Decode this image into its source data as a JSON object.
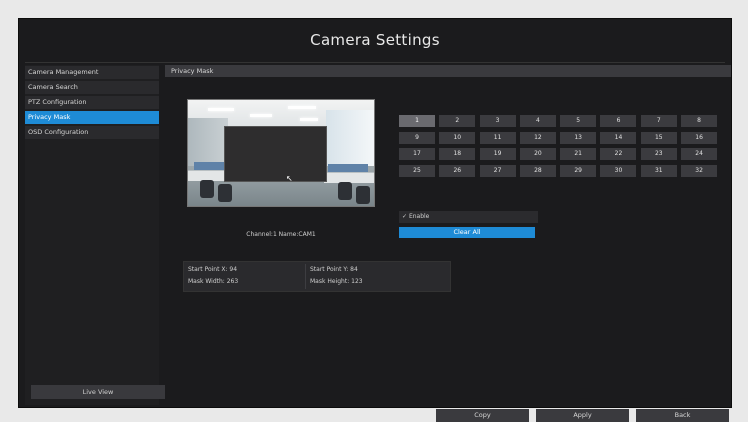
{
  "window": {
    "title": "Camera Settings"
  },
  "sidebar": {
    "items": [
      {
        "label": "Camera Management"
      },
      {
        "label": "Camera Search"
      },
      {
        "label": "PTZ Configuration"
      },
      {
        "label": "Privacy Mask",
        "active": true
      },
      {
        "label": "OSD Configuration"
      }
    ],
    "live_view_label": "Live View"
  },
  "main": {
    "section_title": "Privacy Mask",
    "preview": {
      "channel_label": "Channel:1 Name:CAM1"
    },
    "coordinates": {
      "start_x": "Start Point X: 94",
      "start_y": "Start Point Y: 84",
      "mask_width": "Mask Width: 263",
      "mask_height": "Mask Height: 123"
    },
    "channels": [
      "1",
      "2",
      "3",
      "4",
      "5",
      "6",
      "7",
      "8",
      "9",
      "10",
      "11",
      "12",
      "13",
      "14",
      "15",
      "16",
      "17",
      "18",
      "19",
      "20",
      "21",
      "22",
      "23",
      "24",
      "25",
      "26",
      "27",
      "28",
      "29",
      "30",
      "31",
      "32"
    ],
    "selected_channel": "1",
    "enable_label": "Enable",
    "enable_checked": true,
    "clear_all_label": "Clear All"
  },
  "footer": {
    "copy_label": "Copy",
    "apply_label": "Apply",
    "back_label": "Back"
  },
  "colors": {
    "accent": "#1e8bd6",
    "background": "#1b1b1d"
  }
}
